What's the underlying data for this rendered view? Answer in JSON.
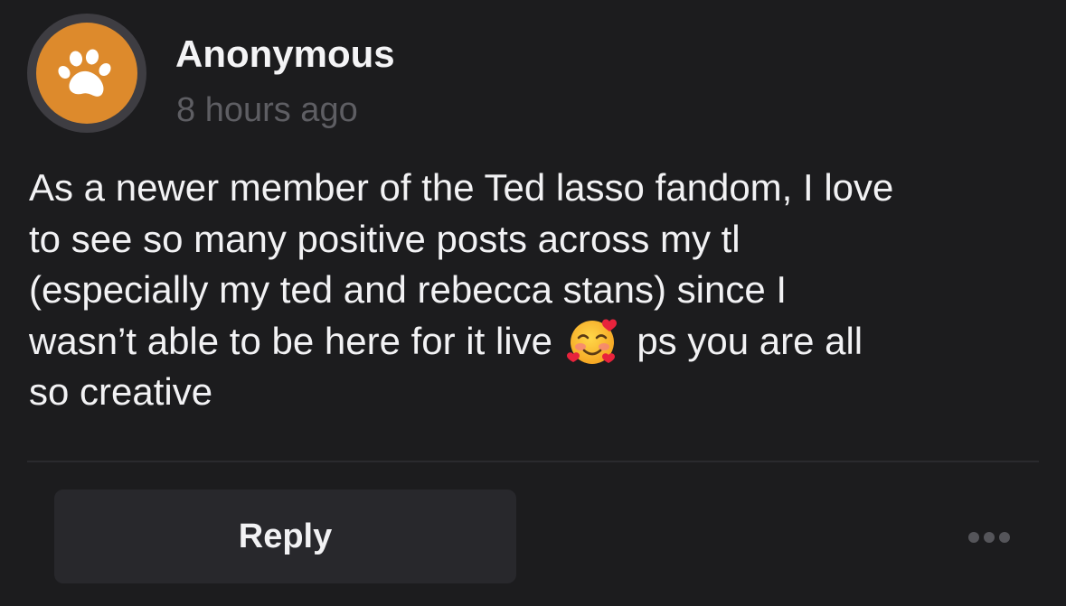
{
  "post": {
    "author": "Anonymous",
    "timestamp": "8 hours ago",
    "avatar_icon": "paw-icon",
    "avatar_color": "#dd8a2c",
    "body_lines": [
      "As a newer member of the Ted lasso fandom, I love",
      "to see so many positive posts across my tl",
      "(especially my ted and rebecca stans) since I",
      "wasn’t able to be here for it live",
      "ps you are all",
      "so creative"
    ],
    "emoji": "smiling-face-with-hearts"
  },
  "actions": {
    "reply_label": "Reply",
    "more_icon": "more-dots-icon"
  }
}
